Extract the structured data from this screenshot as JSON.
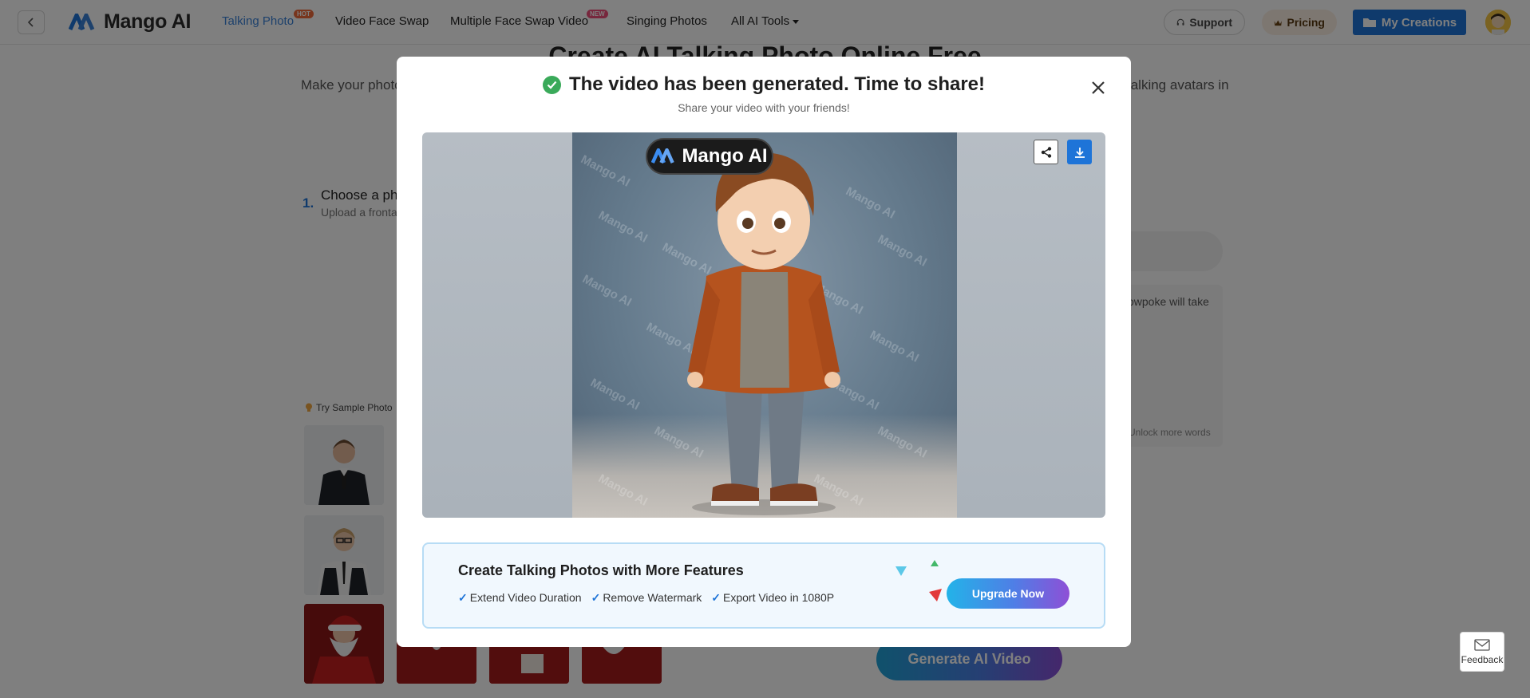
{
  "nav": {
    "brand": "Mango AI",
    "items": [
      {
        "label": "Talking Photo",
        "badge": "HOT",
        "active": true
      },
      {
        "label": "Video Face Swap"
      },
      {
        "label": "Multiple Face Swap Video",
        "badge": "NEW"
      },
      {
        "label": "Singing Photos"
      },
      {
        "label": "All AI Tools"
      }
    ],
    "support": "Support",
    "pricing": "Pricing",
    "my_creations": "My Creations"
  },
  "background": {
    "title": "Create AI Talking Photo Online Free",
    "subtitle_left": "Make your photo",
    "subtitle_right": "talking avatars in",
    "step": {
      "number": "1.",
      "title": "Choose a pho",
      "desc": "Upload a fronta"
    },
    "try_sample": "Try Sample Photo",
    "script_hint": "owpoke will take",
    "unlock": "Unlock more words",
    "generate": "Generate AI Video",
    "feedback": "Feedback"
  },
  "modal": {
    "title": "The video has been generated. Time to share!",
    "subtitle": "Share your video with your friends!",
    "video_badge": "Mango AI",
    "watermark": "Mango AI",
    "upgrade": {
      "title": "Create Talking Photos with More Features",
      "features": [
        "Extend Video Duration",
        "Remove Watermark",
        "Export Video in 1080P"
      ],
      "button": "Upgrade Now"
    }
  },
  "colors": {
    "accent": "#1e74d8",
    "success": "#3aaa5a",
    "hot_badge": "#f06a3a",
    "new_badge": "#ef4f7b"
  }
}
